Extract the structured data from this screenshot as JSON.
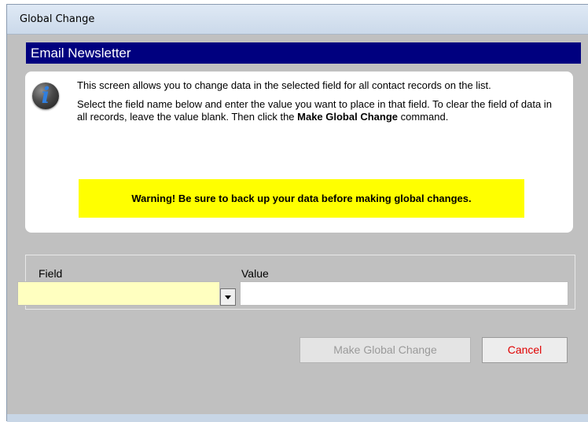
{
  "window": {
    "title": "Global Change"
  },
  "banner": {
    "title": "Email Newsletter"
  },
  "info": {
    "icon": "info-icon",
    "paragraph1": "This screen allows you to change data in the selected field for all contact records on the list.",
    "paragraph2_pre": "Select the field name below and enter the value you want to place in that field.  To clear the field of data in all records, leave the value blank.  Then click the ",
    "paragraph2_bold": "Make Global Change",
    "paragraph2_post": " command.",
    "warning": "Warning! Be sure to back up your data before making global changes."
  },
  "form": {
    "field_label": "Field",
    "field_value": "",
    "value_label": "Value",
    "value_value": ""
  },
  "buttons": {
    "global_change": "Make Global Change",
    "cancel": "Cancel"
  },
  "colors": {
    "banner_bg": "#00007f",
    "warning_bg": "#ffff00",
    "field_bg": "#ffffc0",
    "cancel_text": "#e00000"
  }
}
